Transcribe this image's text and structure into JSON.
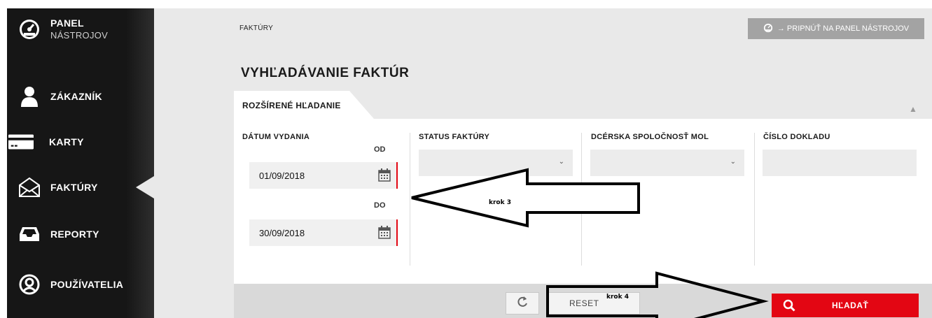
{
  "sidebar": {
    "items": [
      {
        "label": "PANEL",
        "sublabel": "NÁSTROJOV",
        "icon": "dashboard-gauge-icon"
      },
      {
        "label": "ZÁKAZNÍK",
        "icon": "user-icon"
      },
      {
        "label": "KARTY",
        "icon": "credit-card-icon"
      },
      {
        "label": "FAKTÚRY",
        "icon": "envelope-icon",
        "active": true
      },
      {
        "label": "REPORTY",
        "icon": "inbox-tray-icon"
      },
      {
        "label": "POUŽÍVATELIA",
        "icon": "user-circle-icon"
      }
    ]
  },
  "header": {
    "breadcrumb": "FAKTÚRY",
    "pin_button": "→ PRIPNÚŤ NA PANEL NÁSTROJOV",
    "title": "VYHĽADÁVANIE FAKTÚR"
  },
  "search_panel": {
    "tab_label": "ROZŠÍRENÉ HĽADANIE",
    "issue_date": {
      "label": "DÁTUM VYDANIA",
      "from_label": "OD",
      "from_value": "01/09/2018",
      "to_label": "DO",
      "to_value": "30/09/2018"
    },
    "invoice_status": {
      "label": "STATUS FAKTÚRY",
      "value": ""
    },
    "subsidiary": {
      "label": "DCÉRSKA SPOLOČNOSŤ MOL",
      "value": ""
    },
    "document_number": {
      "label": "ČÍSLO DOKLADU",
      "value": ""
    }
  },
  "footer": {
    "reset_label": "RESET",
    "search_label": "HĽADAŤ"
  },
  "annotations": {
    "step3": "krok 3",
    "step4": "krok 4"
  },
  "colors": {
    "sidebar_bg": "#161616",
    "content_bg": "#e9e9e9",
    "accent_red": "#e30613",
    "pin_button_bg": "#a3a3a3"
  }
}
